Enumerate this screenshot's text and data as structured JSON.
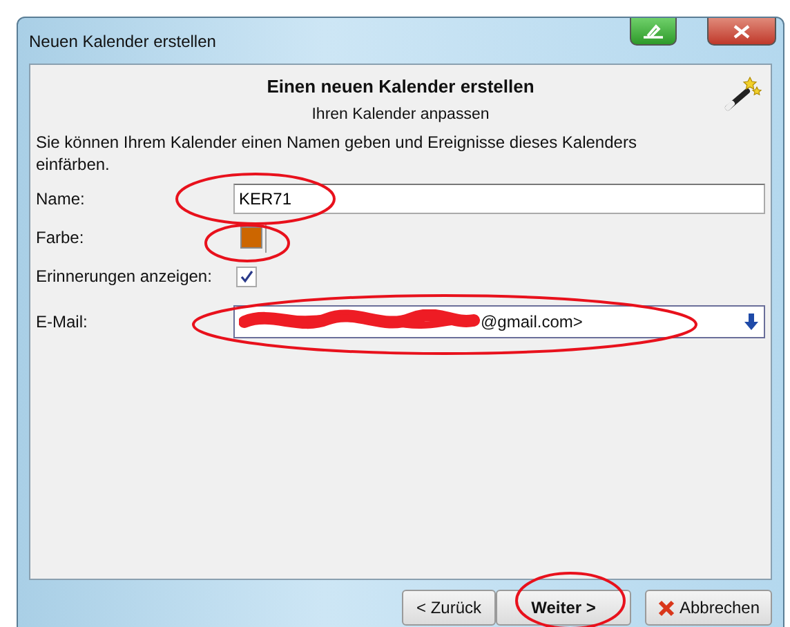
{
  "window": {
    "title": "Neuen Kalender erstellen"
  },
  "header": {
    "title": "Einen neuen Kalender erstellen",
    "subtitle": "Ihren Kalender anpassen"
  },
  "description": "Sie können Ihrem Kalender einen Namen geben und Ereignisse dieses Kalenders einfärben.",
  "fields": [
    {
      "kind": "text",
      "label": "Name:",
      "value": "KER71"
    },
    {
      "kind": "color",
      "label": "Farbe:",
      "color": "#cc6600"
    },
    {
      "kind": "checkbox",
      "label": "Erinnerungen anzeigen:",
      "checked": true
    },
    {
      "kind": "select",
      "label": "E-Mail:",
      "value": "@gmail.com>"
    }
  ],
  "buttons": [
    {
      "kind": "back",
      "label": "< Zurück"
    },
    {
      "kind": "next",
      "label": "Weiter >"
    },
    {
      "kind": "cancel",
      "label": "Abbrechen"
    }
  ]
}
